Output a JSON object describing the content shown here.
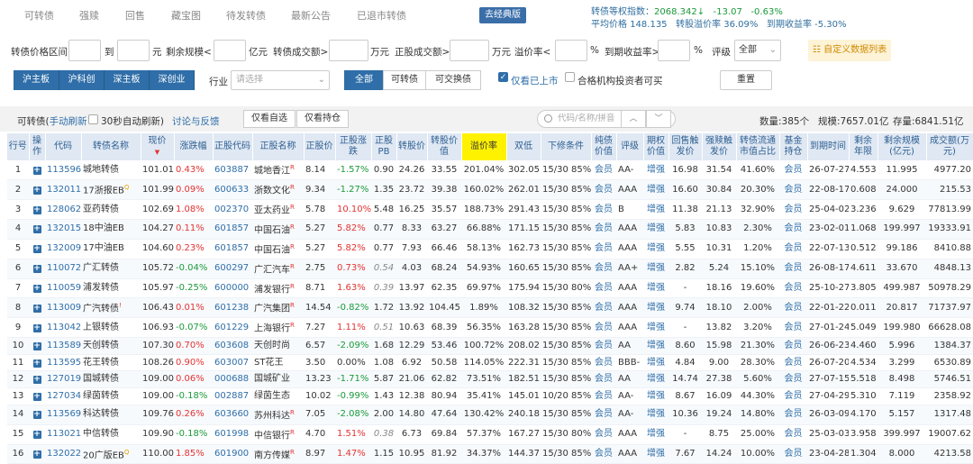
{
  "nav": {
    "tabs": [
      "可转债",
      "强赎",
      "回售",
      "藏宝图",
      "待发转债",
      "最新公告",
      "已退市转债"
    ],
    "classic_btn": "去经典版"
  },
  "index": {
    "equal_weight_label": "转债等权指数：",
    "equal_weight_value": "2068.342",
    "equal_weight_arrow": "↓",
    "equal_weight_change": "-13.07",
    "equal_weight_pct": "-0.63%",
    "avg_price_label": "平均价格",
    "avg_price_value": "148.135",
    "premium_label": "转股溢价率",
    "premium_value": "36.09%",
    "ytm_label": "到期收益率",
    "ytm_value": "-5.30%"
  },
  "filters": {
    "price_range": "转债价格区间",
    "to": "到",
    "yuan": "元",
    "remaining_scale": "剩余规模<",
    "yi_yuan": "亿元",
    "bond_volume": "转债成交额>",
    "wan_yuan1": "万元",
    "stock_volume": "正股成交额>",
    "wan_yuan2": "万元",
    "premium_rate": "溢价率<",
    "pct1": "%",
    "ytm": "到期收益率>",
    "pct2": "%",
    "rating": "评级",
    "rating_value": "全部",
    "custom_btn": "自定义数据列表"
  },
  "markets": [
    "沪主板",
    "沪科创",
    "深主板",
    "深创业"
  ],
  "industry": {
    "label": "行业",
    "placeholder": "请选择"
  },
  "types": [
    "全部",
    "可转债",
    "可交换债"
  ],
  "listed_only": "仅看已上市",
  "qualified_only": "合格机构投资者可买",
  "reset": "重置",
  "toolbar": {
    "title": "可转债(",
    "manual_refresh": "手动刷新",
    "auto_refresh": "30秒自动刷新)",
    "discuss": "讨论与反馈",
    "only_selected": "仅看自选",
    "only_holdings": "仅看持仓",
    "search_placeholder": "代码/名称/拼音",
    "count_label": "数量:",
    "count": "385个",
    "scale_label": "规模:",
    "scale": "7657.01亿",
    "stock_label": "存量:",
    "stock": "6841.51亿"
  },
  "columns": [
    "行号",
    "操作",
    "代码",
    "转债名称",
    "现价",
    "涨跌幅",
    "正股代码",
    "正股名称",
    "正股价",
    "正股涨跌",
    "正股PB",
    "转股价",
    "转股价值",
    "溢价率",
    "双低",
    "下修条件",
    "纯债价值",
    "评级",
    "期权价值",
    "回售触发价",
    "强赎触发价",
    "转债流通市值占比",
    "基金持仓",
    "到期时间",
    "剩余年限",
    "剩余规模(亿元)",
    "成交额(万元)"
  ],
  "rows": [
    [
      "1",
      "",
      "113596",
      "城地转债",
      "",
      "101.010",
      "0.43%",
      "603887",
      "城地香江",
      "R",
      "8.14",
      "-1.57%",
      "0.90",
      "24.26",
      "33.55",
      "201.04%",
      "302.05",
      "15/30 85%",
      "会员",
      "AA-",
      "增强",
      "16.98",
      "31.54",
      "41.60%",
      "会员",
      "26-07-27",
      "4.553",
      "11.995",
      "4977.20"
    ],
    [
      "2",
      "",
      "132011",
      "17浙报EB",
      "Q",
      "101.990",
      "0.09%",
      "600633",
      "浙数文化",
      "R",
      "9.34",
      "-1.27%",
      "1.35",
      "23.72",
      "39.38",
      "160.02%",
      "262.01",
      "15/30 85%",
      "会员",
      "AAA",
      "增强",
      "16.60",
      "30.84",
      "20.30%",
      "会员",
      "22-08-17",
      "0.608",
      "24.000",
      "215.53"
    ],
    [
      "3",
      "",
      "128062",
      "亚药转债",
      "",
      "102.699",
      "1.08%",
      "002370",
      "亚太药业",
      "R",
      "5.78",
      "10.10%",
      "5.48",
      "16.25",
      "35.57",
      "188.73%",
      "291.43",
      "15/30 85%",
      "会员",
      "B",
      "增强",
      "11.38",
      "21.13",
      "32.90%",
      "会员",
      "25-04-02",
      "3.236",
      "9.629",
      "77813.99"
    ],
    [
      "4",
      "",
      "132015",
      "18中油EB",
      "",
      "104.270",
      "0.11%",
      "601857",
      "中国石油",
      "R",
      "5.27",
      "5.82%",
      "0.77",
      "8.33",
      "63.27",
      "66.88%",
      "171.15",
      "15/30 85%",
      "会员",
      "AAA",
      "增强",
      "5.83",
      "10.83",
      "2.30%",
      "会员",
      "23-02-01",
      "1.068",
      "199.997",
      "19333.91"
    ],
    [
      "5",
      "",
      "132009",
      "17中油EB",
      "",
      "104.600",
      "0.23%",
      "601857",
      "中国石油",
      "R",
      "5.27",
      "5.82%",
      "0.77",
      "7.93",
      "66.46",
      "58.13%",
      "162.73",
      "15/30 85%",
      "会员",
      "AAA",
      "增强",
      "5.55",
      "10.31",
      "1.20%",
      "会员",
      "22-07-13",
      "0.512",
      "99.186",
      "8410.88"
    ],
    [
      "6",
      "",
      "110072",
      "广汇转债",
      "",
      "105.720",
      "-0.04%",
      "600297",
      "广汇汽车",
      "R",
      "2.75",
      "0.73%",
      "0.54",
      "4.03",
      "68.24",
      "54.93%",
      "160.65",
      "15/30 85%",
      "会员",
      "AA+",
      "增强",
      "2.82",
      "5.24",
      "15.10%",
      "会员",
      "26-08-17",
      "4.611",
      "33.670",
      "4848.13"
    ],
    [
      "7",
      "",
      "110059",
      "浦发转债",
      "",
      "105.970",
      "-0.25%",
      "600000",
      "浦发银行",
      "R",
      "8.71",
      "1.63%",
      "0.39",
      "13.97",
      "62.35",
      "69.97%",
      "175.94",
      "15/30 80%",
      "会员",
      "AAA",
      "增强",
      "-",
      "18.16",
      "19.60%",
      "会员",
      "25-10-27",
      "3.805",
      "499.987",
      "50978.29"
    ],
    [
      "8",
      "",
      "113009",
      "广汽转债",
      "!",
      "106.430",
      "0.01%",
      "601238",
      "广汽集团",
      "R",
      "14.54",
      "-0.82%",
      "1.72",
      "13.92",
      "104.45",
      "1.89%",
      "108.32",
      "15/30 85%",
      "会员",
      "AAA",
      "增强",
      "9.74",
      "18.10",
      "2.00%",
      "会员",
      "22-01-22",
      "0.011",
      "20.817",
      "71737.97"
    ],
    [
      "9",
      "",
      "113042",
      "上银转债",
      "",
      "106.930",
      "-0.07%",
      "601229",
      "上海银行",
      "R",
      "7.27",
      "1.11%",
      "0.51",
      "10.63",
      "68.39",
      "56.35%",
      "163.28",
      "15/30 85%",
      "会员",
      "AAA",
      "增强",
      "-",
      "13.82",
      "3.20%",
      "会员",
      "27-01-24",
      "5.049",
      "199.980",
      "66628.08"
    ],
    [
      "10",
      "",
      "113589",
      "天创转债",
      "",
      "107.300",
      "0.70%",
      "603608",
      "天创时尚",
      "",
      "6.57",
      "-2.09%",
      "1.68",
      "12.29",
      "53.46",
      "100.72%",
      "208.02",
      "15/30 85%",
      "会员",
      "AA",
      "增强",
      "8.60",
      "15.98",
      "21.30%",
      "会员",
      "26-06-23",
      "4.460",
      "5.996",
      "1384.37"
    ],
    [
      "11",
      "",
      "113595",
      "花王转债",
      "",
      "108.260",
      "0.90%",
      "603007",
      "ST花王",
      "",
      "3.50",
      "0.00%",
      "1.08",
      "6.92",
      "50.58",
      "114.05%",
      "222.31",
      "15/30 85%",
      "会员",
      "BBB-",
      "增强",
      "4.84",
      "9.00",
      "28.30%",
      "会员",
      "26-07-20",
      "4.534",
      "3.299",
      "6530.89"
    ],
    [
      "12",
      "",
      "127019",
      "国城转债",
      "",
      "109.000",
      "0.06%",
      "000688",
      "国城矿业",
      "",
      "13.23",
      "-1.71%",
      "5.87",
      "21.06",
      "62.82",
      "73.51%",
      "182.51",
      "15/30 85%",
      "会员",
      "AA",
      "增强",
      "14.74",
      "27.38",
      "5.60%",
      "会员",
      "27-07-15",
      "5.518",
      "8.498",
      "5746.51"
    ],
    [
      "13",
      "",
      "127034",
      "绿茵转债",
      "",
      "109.000",
      "-0.18%",
      "002887",
      "绿茵生态",
      "",
      "10.02",
      "-0.99%",
      "1.43",
      "12.38",
      "80.94",
      "35.41%",
      "145.01",
      "10/20 85%",
      "会员",
      "AA-",
      "增强",
      "8.67",
      "16.09",
      "44.30%",
      "会员",
      "27-04-29",
      "5.310",
      "7.119",
      "2358.92"
    ],
    [
      "14",
      "",
      "113569",
      "科达转债",
      "",
      "109.760",
      "0.26%",
      "603660",
      "苏州科达",
      "R",
      "7.05",
      "-2.08%",
      "2.00",
      "14.80",
      "47.64",
      "130.42%",
      "240.18",
      "15/30 85%",
      "会员",
      "AA-",
      "增强",
      "10.36",
      "19.24",
      "14.80%",
      "会员",
      "26-03-09",
      "4.170",
      "5.157",
      "1317.48"
    ],
    [
      "15",
      "",
      "113021",
      "中信转债",
      "",
      "109.900",
      "-0.18%",
      "601998",
      "中信银行",
      "R",
      "4.70",
      "1.51%",
      "0.38",
      "6.73",
      "69.84",
      "57.37%",
      "167.27",
      "15/30 80%",
      "会员",
      "AAA",
      "增强",
      "-",
      "8.75",
      "25.00%",
      "会员",
      "25-03-03",
      "3.958",
      "399.997",
      "19007.62"
    ],
    [
      "16",
      "",
      "132022",
      "20广版EB",
      "Q",
      "110.000",
      "1.85%",
      "601900",
      "南方传媒",
      "R",
      "8.97",
      "1.47%",
      "1.15",
      "10.95",
      "81.92",
      "34.37%",
      "144.37",
      "15/30 85%",
      "会员",
      "AAA",
      "增强",
      "7.67",
      "14.24",
      "10.00%",
      "会员",
      "23-04-28",
      "1.304",
      "8.000",
      "4213.58"
    ]
  ]
}
